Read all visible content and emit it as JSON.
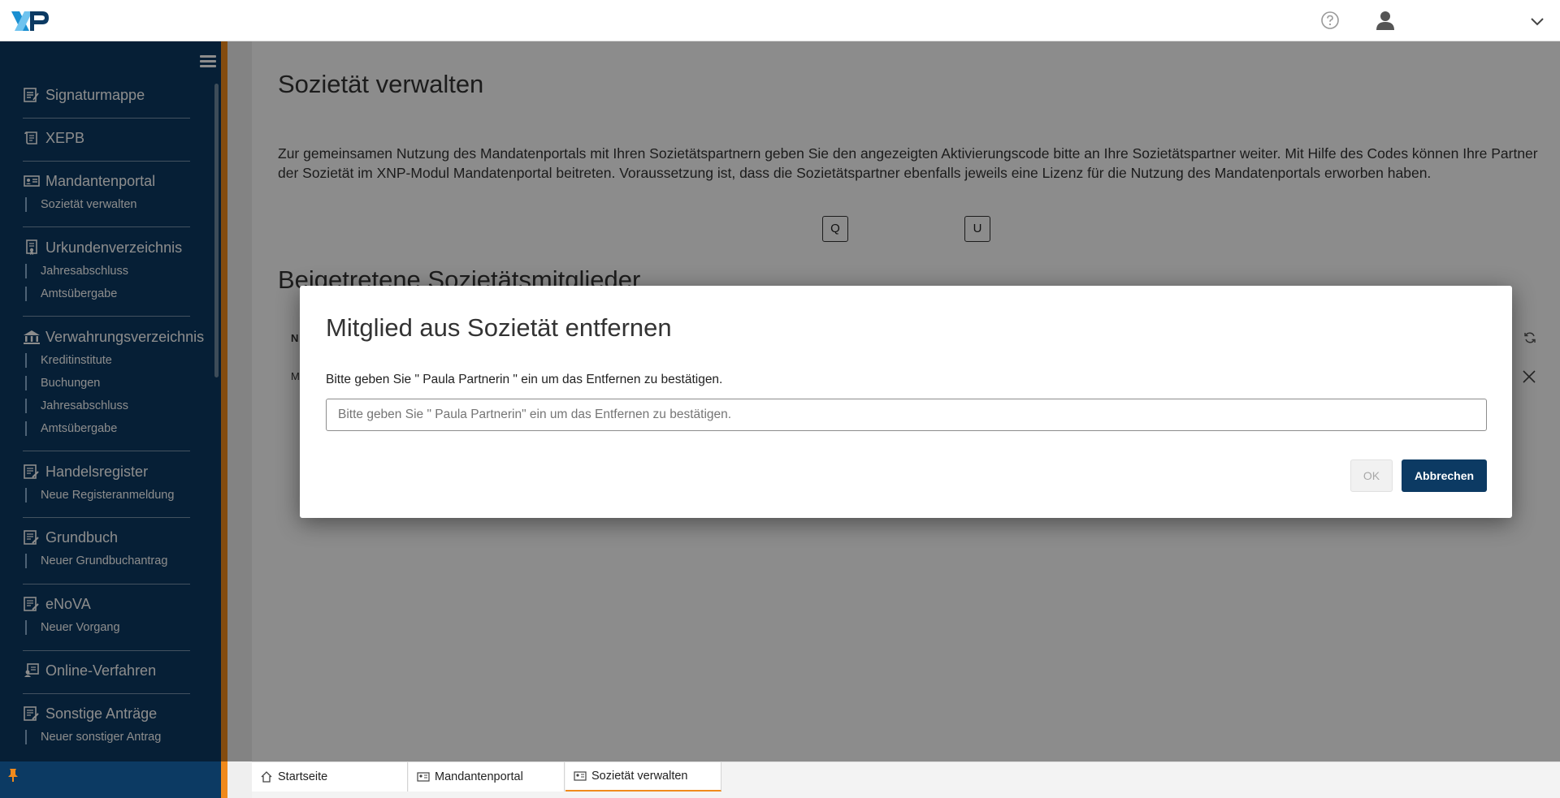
{
  "colors": {
    "sidebar_bg": "#0c3a63",
    "accent": "#f08a1c",
    "primary_button": "#0c3a63"
  },
  "header": {
    "logo_text": "XNP",
    "icons": [
      "help-icon",
      "user-icon",
      "chevron-down-icon"
    ]
  },
  "sidebar": {
    "groups": [
      {
        "label": "Signaturmappe",
        "icon": "signature-folder-icon",
        "items": []
      },
      {
        "label": "XEPB",
        "icon": "scroll-icon",
        "items": []
      },
      {
        "label": "Mandantenportal",
        "icon": "id-card-icon",
        "items": [
          "Sozietät verwalten"
        ]
      },
      {
        "label": "Urkundenverzeichnis",
        "icon": "document-badge-icon",
        "items": [
          "Jahresabschluss",
          "Amtsübergabe"
        ]
      },
      {
        "label": "Verwahrungsverzeichnis",
        "icon": "bank-icon",
        "items": [
          "Kreditinstitute",
          "Buchungen",
          "Jahresabschluss",
          "Amtsübergabe"
        ]
      },
      {
        "label": "Handelsregister",
        "icon": "register-edit-icon",
        "items": [
          "Neue Registeranmeldung"
        ]
      },
      {
        "label": "Grundbuch",
        "icon": "register-edit-icon",
        "items": [
          "Neuer Grundbuchantrag"
        ]
      },
      {
        "label": "eNoVA",
        "icon": "register-edit-icon",
        "items": [
          "Neuer Vorgang"
        ]
      },
      {
        "label": "Online-Verfahren",
        "icon": "online-procedure-icon",
        "items": []
      },
      {
        "label": "Sonstige Anträge",
        "icon": "register-edit-icon",
        "items": [
          "Neuer sonstiger Antrag"
        ]
      }
    ]
  },
  "main": {
    "title": "Sozietät verwalten",
    "intro": "Zur gemeinsamen Nutzung des Mandatenportals mit Ihren Sozietätspartnern geben Sie den angezeigten Aktivierungscode bitte an Ihre Sozietätspartner weiter. Mit Hilfe des Codes können Ihre Partner der Sozietät im XNP-Modul Mandatenportal beitreten. Voraussetzung ist, dass die Sozietätspartner ebenfalls jeweils eine Lizenz für die Nutzung des Mandatenportals erworben haben.",
    "code_first": "Q",
    "code_last": "U",
    "members_title": "Beigetretene Sozietätsmitglieder",
    "table_header_initial": "N",
    "row_initial": "M"
  },
  "modal": {
    "title": "Mitglied aus Sozietät entfernen",
    "label": "Bitte geben Sie \" Paula Partnerin \" ein um das Entfernen zu bestätigen.",
    "input_value": "",
    "input_placeholder": "Bitte geben Sie \" Paula Partnerin\" ein um das Entfernen zu bestätigen.",
    "ok_label": "OK",
    "cancel_label": "Abbrechen"
  },
  "tabs": [
    {
      "label": "Startseite",
      "icon": "home-icon",
      "active": false
    },
    {
      "label": "Mandantenportal",
      "icon": "id-card-icon",
      "active": false
    },
    {
      "label": "Sozietät verwalten",
      "icon": "id-card-icon",
      "active": true
    }
  ]
}
